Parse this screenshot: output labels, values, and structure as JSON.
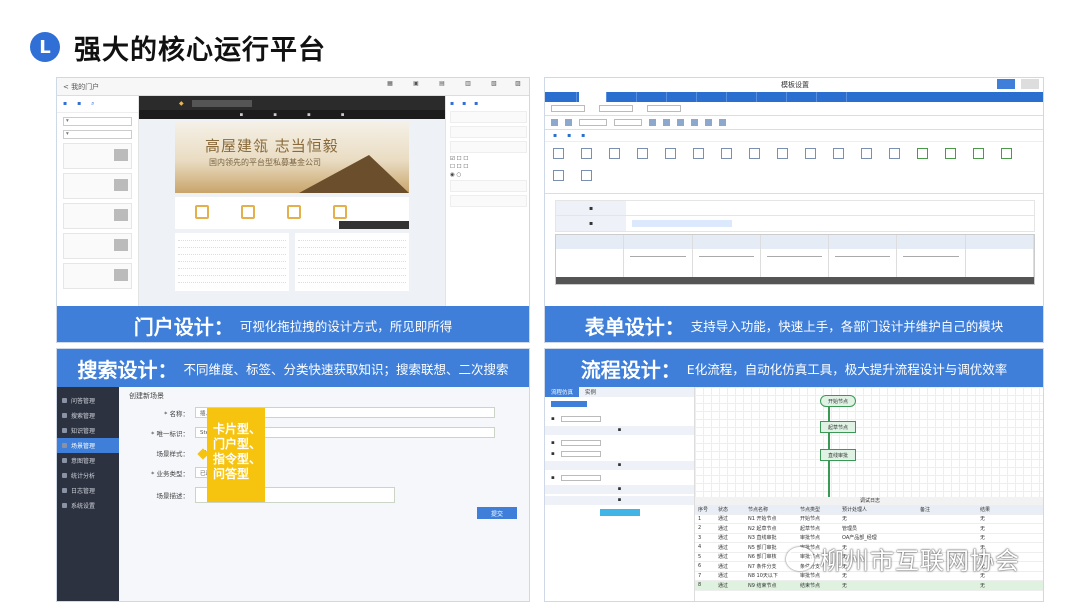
{
  "header": {
    "badge": "L",
    "title": "强大的核心运行平台"
  },
  "panels": {
    "portal": {
      "title": "门户设计：",
      "desc": "可视化拖拉拽的设计方式，所见即所得",
      "hero_line1": "高屋建瓴 志当恒毅",
      "hero_line2": "国内领先的平台型私募基金公司",
      "back": "< 我的门户"
    },
    "form": {
      "title": "表单设计：",
      "desc": "支持导入功能，快速上手，各部门设计并维护自己的模块",
      "window_title": "模板设置"
    },
    "search": {
      "title": "搜索设计：",
      "desc": "不同维度、标签、分类快速获取知识；搜索联想、二次搜索",
      "page_title": "创建新场景",
      "fields": [
        {
          "label": "* 名称：",
          "value": "插入员"
        },
        {
          "label": "* 唯一标识：",
          "value": "Stevenyuan"
        },
        {
          "label": "场景样式：",
          "value": "卡片型"
        },
        {
          "label": "* 业务类型：",
          "value": "已选择"
        },
        {
          "label": "场景描述：",
          "value": ""
        }
      ],
      "ok_button": "提交",
      "callout": [
        "卡片型、",
        "门户型、",
        "指令型、",
        "问答型"
      ],
      "sidebar": [
        "问答管理",
        "搜索管理",
        "知识管理",
        "场景管理",
        "意图管理",
        "统计分析",
        "日志管理",
        "系统设置"
      ]
    },
    "flow": {
      "title": "流程设计：",
      "desc": "E化流程，自动化仿真工具，极大提升流程设计与调优效率",
      "tabs": [
        "流程仿真",
        "实例"
      ],
      "nodes": [
        "开始节点",
        "起草节点",
        "直线审批"
      ],
      "log_title": "调试日志",
      "table_header": [
        "序号",
        "状态",
        "节点名称",
        "节点类型",
        "预计处理人",
        "备注",
        "结果"
      ],
      "rows": [
        [
          "1",
          "通过",
          "N1 开始节点",
          "开始节点",
          "无",
          "",
          "无"
        ],
        [
          "2",
          "通过",
          "N2 起草节点",
          "起草节点",
          "管理员",
          "",
          "无"
        ],
        [
          "3",
          "通过",
          "N3 直线审批",
          "审批节点",
          "OA产品部_经理",
          "",
          "无"
        ],
        [
          "4",
          "通过",
          "N5 部门审批",
          "审批节点",
          "无",
          "",
          "无"
        ],
        [
          "5",
          "通过",
          "N6 部门审核",
          "审批节点",
          "无",
          "",
          "无"
        ],
        [
          "6",
          "通过",
          "N7 条件分支",
          "条件分支",
          "无",
          "",
          "无"
        ],
        [
          "7",
          "通过",
          "N8 10天以下",
          "审批节点",
          "无",
          "",
          "无"
        ],
        [
          "8",
          "通过",
          "N9 结束节点",
          "结束节点",
          "无",
          "",
          "无"
        ]
      ]
    }
  },
  "watermark": "柳州市互联网协会",
  "colors": {
    "banner": "#3f7fd9",
    "callout": "#f6c30f",
    "badge": "#2f6fd6"
  }
}
